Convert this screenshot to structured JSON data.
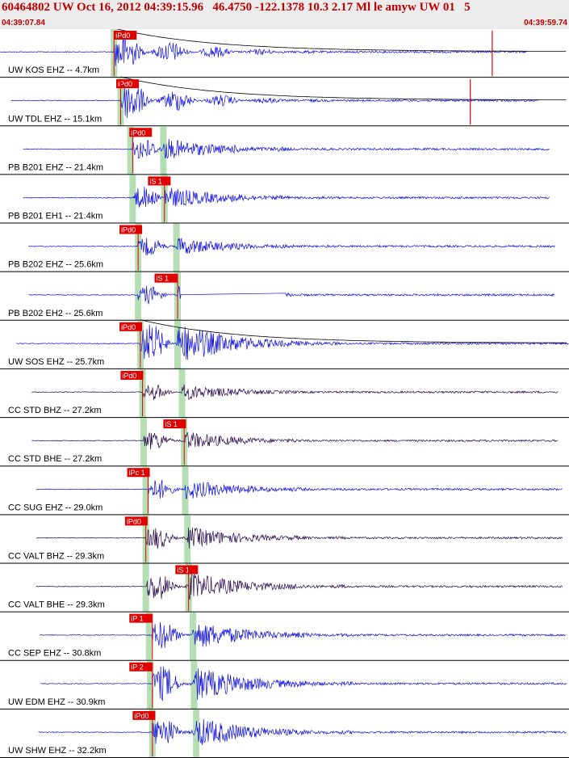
{
  "header": {
    "title": "60464802 UW Oct 16, 2012 04:39:15.96   46.4750 -122.1378 10.3 2.17 Ml le amyw UW 01   5",
    "start_time": "04:39:07.84",
    "end_time": "04:39:59.74"
  },
  "colors": {
    "blue_trace": "#1010e0",
    "purple_trace": "#2a0a50",
    "pick_box": "#e00000",
    "phase_band": "#a8d8a8",
    "coda_curve": "#000000",
    "panel_border": "#000000"
  },
  "chart_data": {
    "type": "seismogram",
    "x_range_seconds": [
      0,
      51.9
    ],
    "traces": [
      {
        "label": "UW KOS EHZ -- 4.7km",
        "color": "blue",
        "p_pick": "iPd0",
        "p_time": 10.4,
        "s_pick": "",
        "s_time": null,
        "p_band": 10.4,
        "s_band": null,
        "signal_start": 10.4,
        "trace_start": 0.0,
        "trace_end": 48.1,
        "amp": 1.0,
        "coda": true,
        "spike": 44.9,
        "gap": null
      },
      {
        "label": "UW TDL EHZ -- 15.1km",
        "color": "blue",
        "p_pick": "iPd0",
        "p_time": 10.6,
        "s_pick": "",
        "s_time": null,
        "p_band": 11.0,
        "s_band": null,
        "signal_start": 11.0,
        "trace_start": 1.0,
        "trace_end": 49.1,
        "amp": 1.0,
        "coda": true,
        "spike": 42.9,
        "gap": null
      },
      {
        "label": "PB B201 EHZ -- 21.4km",
        "color": "blue",
        "p_pick": "iPd0",
        "p_time": 11.8,
        "s_pick": "",
        "s_time": null,
        "p_band": 11.9,
        "s_band": 14.9,
        "signal_start": 12.1,
        "trace_start": 2.1,
        "trace_end": 50.1,
        "amp": 0.55,
        "coda": false,
        "spike": null,
        "gap": null
      },
      {
        "label": "PB B201 EH1 -- 21.4km",
        "color": "blue",
        "p_pick": "",
        "p_time": null,
        "s_pick": "iS 1",
        "s_time": 13.5,
        "p_band": 12.1,
        "s_band": 15.0,
        "signal_start": 12.1,
        "trace_start": 2.1,
        "trace_end": 50.1,
        "amp": 0.55,
        "coda": false,
        "spike": null,
        "gap": null
      },
      {
        "label": "PB B202 EHZ -- 25.6km",
        "color": "blue",
        "p_pick": "iPd0",
        "p_time": 10.9,
        "s_pick": "",
        "s_time": null,
        "p_band": 12.6,
        "s_band": 16.1,
        "signal_start": 12.6,
        "trace_start": 2.6,
        "trace_end": 50.6,
        "amp": 0.45,
        "coda": false,
        "spike": null,
        "gap": null
      },
      {
        "label": "PB B202 EH2 -- 25.6km",
        "color": "blue",
        "p_pick": "",
        "p_time": null,
        "s_pick": "iS 1",
        "s_time": 14.1,
        "p_band": 12.6,
        "s_band": 16.2,
        "signal_start": 12.6,
        "trace_start": 2.6,
        "trace_end": 50.6,
        "amp": 0.45,
        "coda": false,
        "spike": null,
        "gap": [
          16.5,
          26.0
        ]
      },
      {
        "label": "UW SOS EHZ -- 25.7km",
        "color": "blue",
        "p_pick": "iPd0",
        "p_time": 10.9,
        "s_pick": "",
        "s_time": null,
        "p_band": 12.8,
        "s_band": 16.2,
        "signal_start": 12.8,
        "trace_start": 1.5,
        "trace_end": 51.9,
        "amp": 1.0,
        "coda": true,
        "spike": null,
        "gap": null
      },
      {
        "label": "CC STD BHZ -- 27.2km",
        "color": "purple",
        "p_pick": "iPd0",
        "p_time": 11.0,
        "s_pick": "",
        "s_time": null,
        "p_band": 13.0,
        "s_band": 16.6,
        "signal_start": 13.0,
        "trace_start": 2.9,
        "trace_end": 50.9,
        "amp": 0.4,
        "coda": false,
        "spike": null,
        "gap": null
      },
      {
        "label": "CC STD BHE -- 27.2km",
        "color": "purple",
        "p_pick": "",
        "p_time": null,
        "s_pick": "iS 1",
        "s_time": 14.9,
        "p_band": 13.1,
        "s_band": 16.8,
        "signal_start": 13.1,
        "trace_start": 2.9,
        "trace_end": 50.9,
        "amp": 0.45,
        "coda": false,
        "spike": null,
        "gap": null
      },
      {
        "label": "CC SUG EHZ -- 29.0km",
        "color": "blue",
        "p_pick": "iPc 1",
        "p_time": 11.6,
        "s_pick": "",
        "s_time": null,
        "p_band": 13.3,
        "s_band": 16.9,
        "signal_start": 13.5,
        "trace_start": 3.3,
        "trace_end": 51.3,
        "amp": 0.5,
        "coda": false,
        "spike": null,
        "gap": null
      },
      {
        "label": "CC VALT BHZ -- 29.3km",
        "color": "purple",
        "p_pick": "iPd0",
        "p_time": 11.4,
        "s_pick": "",
        "s_time": null,
        "p_band": 13.3,
        "s_band": 17.1,
        "signal_start": 13.3,
        "trace_start": 3.3,
        "trace_end": 51.3,
        "amp": 0.55,
        "coda": false,
        "spike": null,
        "gap": null
      },
      {
        "label": "CC VALT BHE -- 29.3km",
        "color": "purple",
        "p_pick": "",
        "p_time": null,
        "s_pick": "iS 1",
        "s_time": 16.0,
        "p_band": 13.3,
        "s_band": 17.2,
        "signal_start": 13.4,
        "trace_start": 3.3,
        "trace_end": 51.3,
        "amp": 0.7,
        "coda": false,
        "spike": null,
        "gap": null
      },
      {
        "label": "CC SEP EHZ -- 30.8km",
        "color": "blue",
        "p_pick": "iP 1",
        "p_time": 11.8,
        "s_pick": "",
        "s_time": null,
        "p_band": 13.6,
        "s_band": 17.6,
        "signal_start": 13.9,
        "trace_start": 3.6,
        "trace_end": 51.6,
        "amp": 0.7,
        "coda": false,
        "spike": null,
        "gap": null
      },
      {
        "label": "UW EDM EHZ -- 30.9km",
        "color": "blue",
        "p_pick": "iP 2",
        "p_time": 11.8,
        "s_pick": "",
        "s_time": null,
        "p_band": 13.7,
        "s_band": 17.7,
        "signal_start": 13.9,
        "trace_start": 3.7,
        "trace_end": 51.7,
        "amp": 0.85,
        "coda": false,
        "spike": null,
        "gap": null
      },
      {
        "label": "UW SHW EHZ -- 32.2km",
        "color": "blue",
        "p_pick": "iPd0",
        "p_time": 12.1,
        "s_pick": "",
        "s_time": null,
        "p_band": 13.9,
        "s_band": 17.9,
        "signal_start": 13.9,
        "trace_start": 3.5,
        "trace_end": 51.7,
        "amp": 0.75,
        "coda": false,
        "spike": null,
        "gap": null
      }
    ]
  }
}
